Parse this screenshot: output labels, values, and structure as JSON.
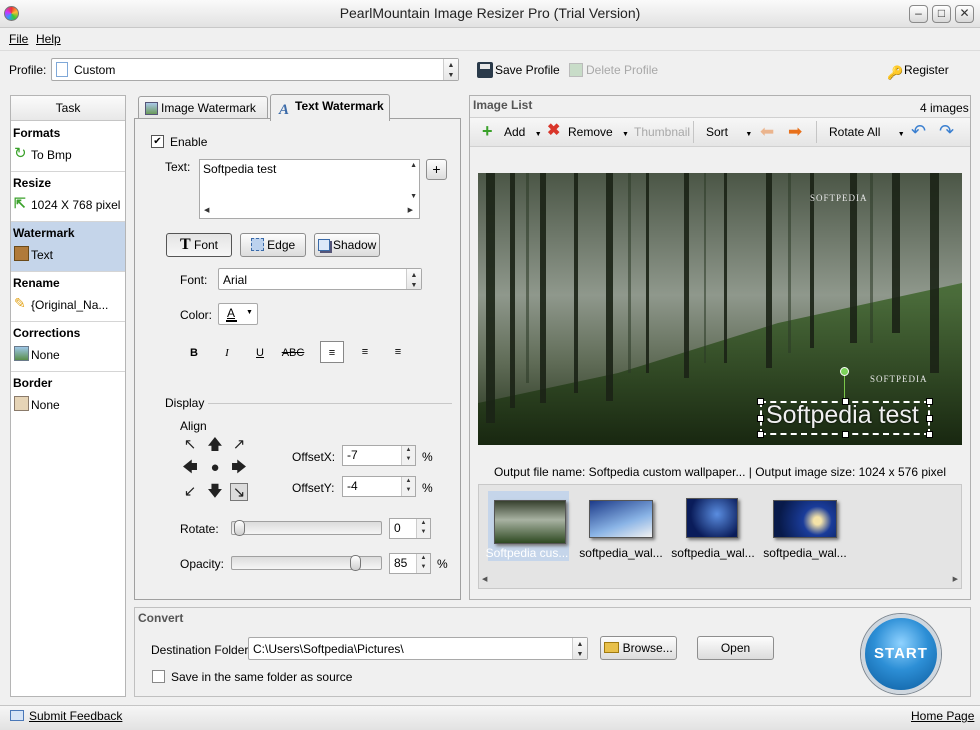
{
  "window": {
    "title": "PearlMountain Image Resizer Pro (Trial Version)"
  },
  "menu": {
    "file": "File",
    "help": "Help"
  },
  "profile": {
    "label": "Profile:",
    "value": "Custom",
    "save": "Save Profile",
    "delete": "Delete Profile",
    "register": "Register"
  },
  "tasks": {
    "header": "Task",
    "items": [
      {
        "title": "Formats",
        "value": "To Bmp",
        "icon": "convert-icon"
      },
      {
        "title": "Resize",
        "value": "1024 X 768 pixel",
        "icon": "resize-icon"
      },
      {
        "title": "Watermark",
        "value": "Text",
        "icon": "watermark-icon"
      },
      {
        "title": "Rename",
        "value": "{Original_Na...",
        "icon": "pencil-icon"
      },
      {
        "title": "Corrections",
        "value": "None",
        "icon": "corrections-icon"
      },
      {
        "title": "Border",
        "value": "None",
        "icon": "border-icon"
      }
    ]
  },
  "watermark": {
    "tab_image": "Image Watermark",
    "tab_text": "Text Watermark",
    "enable": "Enable",
    "text_label": "Text:",
    "text_value": "Softpedia test",
    "add_symbol": "+",
    "btn_font": "Font",
    "btn_edge": "Edge",
    "btn_shadow": "Shadow",
    "font_label": "Font:",
    "font_value": "Arial",
    "color_label": "Color:",
    "color_glyph": "A",
    "color_value": "#000000",
    "bold": "B",
    "italic": "I",
    "underline": "U",
    "strike": "ABC",
    "display": "Display",
    "align": "Align",
    "offsetx_label": "OffsetX:",
    "offsetx": "-7",
    "offsety_label": "OffsetY:",
    "offsety": "-4",
    "percent": "%",
    "rotate_label": "Rotate:",
    "rotate": "0",
    "rotate_level": 0,
    "opacity_label": "Opacity:",
    "opacity": "85",
    "opacity_level": 0.85
  },
  "imagelist": {
    "title": "Image List",
    "count": "4 images",
    "add": "Add",
    "remove": "Remove",
    "thumbnail": "Thumbnail",
    "sort": "Sort",
    "rotate_all": "Rotate All",
    "preview_text": "Softpedia test",
    "preview_logo": "SOFTPEDIA",
    "output_info": "Output file name: Softpedia custom wallpaper... | Output image size:  1024 x 576 pixel",
    "thumbs": [
      "Softpedia cus...",
      "softpedia_wal...",
      "softpedia_wal...",
      "softpedia_wal..."
    ]
  },
  "convert": {
    "title": "Convert",
    "dest_label": "Destination Folder:",
    "dest_value": "C:\\Users\\Softpedia\\Pictures\\",
    "browse": "Browse...",
    "open": "Open",
    "same_folder": "Save in the same folder as source",
    "start": "START"
  },
  "status": {
    "feedback": "Submit Feedback",
    "home": "Home Page"
  },
  "colors": {
    "accent": "#2d8fd6",
    "selection": "#c5d5ea",
    "add_green": "#3aa12a",
    "remove_red": "#d9352a",
    "arrow_orange": "#e8701a",
    "arrow_blue": "#3a7fd0"
  }
}
